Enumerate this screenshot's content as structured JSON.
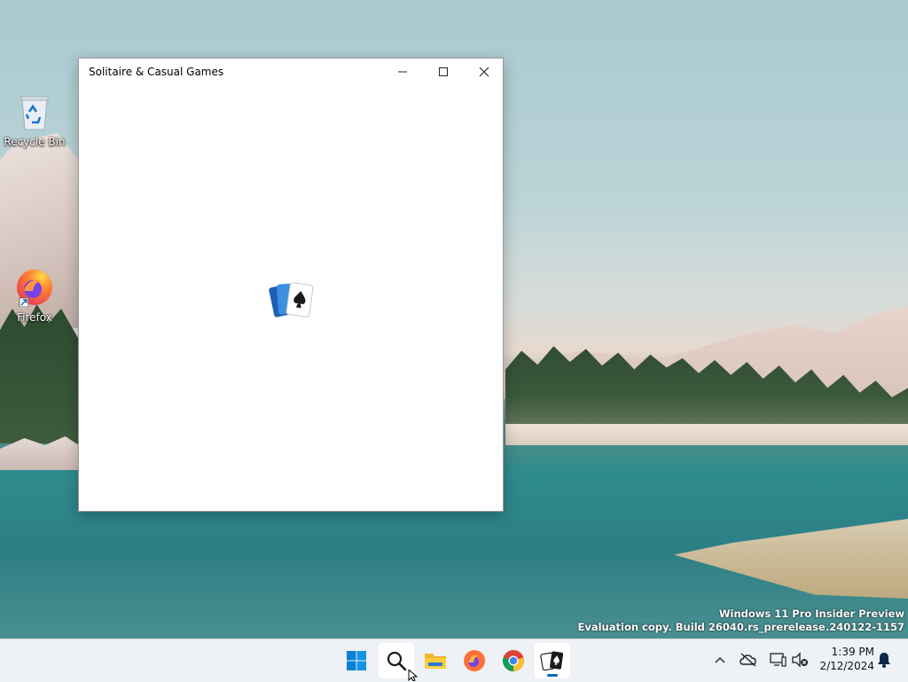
{
  "desktop": {
    "icons": [
      {
        "label": "Recycle Bin",
        "icon": "recycle-bin-icon"
      },
      {
        "label": "Firefox",
        "icon": "firefox-icon"
      }
    ],
    "watermark": {
      "line1": "Windows 11 Pro Insider Preview",
      "line2": "Evaluation copy. Build 26040.rs_prerelease.240122-1157"
    }
  },
  "window": {
    "title": "Solitaire & Casual Games",
    "controls": [
      "minimize-icon",
      "maximize-icon",
      "close-icon"
    ],
    "splash_icon": "solitaire-cards-icon"
  },
  "taskbar": {
    "items": [
      {
        "name": "start",
        "icon": "windows-logo-icon"
      },
      {
        "name": "search",
        "icon": "search-icon"
      },
      {
        "name": "file-explorer",
        "icon": "folder-icon"
      },
      {
        "name": "firefox",
        "icon": "firefox-icon"
      },
      {
        "name": "chrome",
        "icon": "chrome-icon"
      },
      {
        "name": "solitaire",
        "icon": "solitaire-cards-icon",
        "active": true
      }
    ],
    "tray": [
      "chevron-up-icon",
      "onedrive-offline-icon",
      "network-icon",
      "volume-muted-icon"
    ],
    "clock": {
      "time": "1:39 PM",
      "date": "2/12/2024"
    },
    "notification_icon": "bell-icon"
  },
  "colors": {
    "accent": "#0067c0",
    "taskbar_bg": "#eef1f5",
    "window_bg": "#ffffff"
  }
}
